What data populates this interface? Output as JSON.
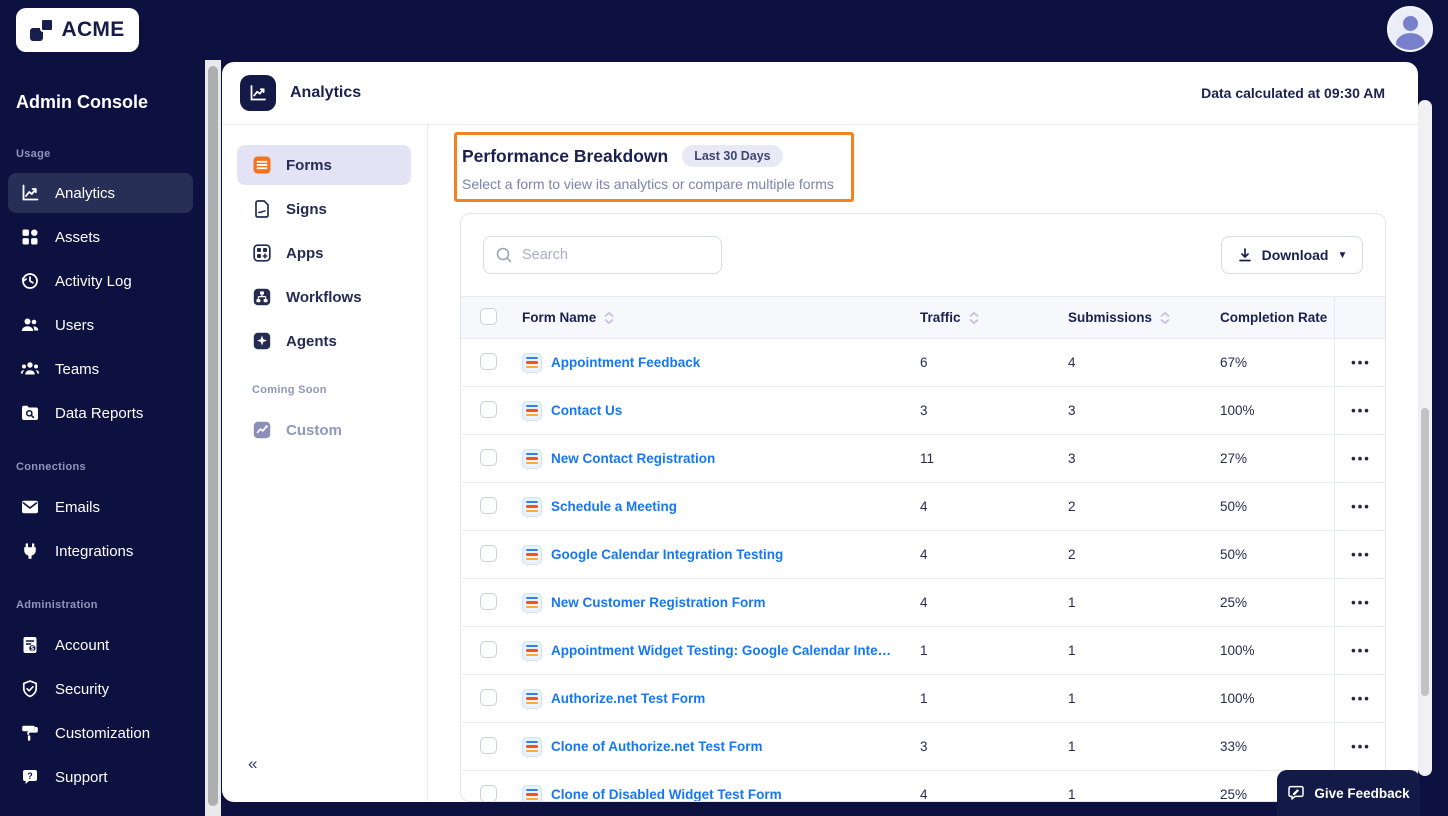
{
  "topbar": {
    "logo_text": "ACME"
  },
  "sidebar": {
    "title": "Admin Console",
    "sections": [
      {
        "label": "Usage",
        "items": [
          {
            "label": "Analytics",
            "active": true
          },
          {
            "label": "Assets"
          },
          {
            "label": "Activity Log"
          },
          {
            "label": "Users"
          },
          {
            "label": "Teams"
          },
          {
            "label": "Data Reports"
          }
        ]
      },
      {
        "label": "Connections",
        "items": [
          {
            "label": "Emails"
          },
          {
            "label": "Integrations"
          }
        ]
      },
      {
        "label": "Administration",
        "items": [
          {
            "label": "Account"
          },
          {
            "label": "Security"
          },
          {
            "label": "Customization"
          },
          {
            "label": "Support"
          }
        ]
      }
    ]
  },
  "header": {
    "title": "Analytics",
    "data_note": "Data calculated at 09:30 AM"
  },
  "subnav": {
    "items": [
      {
        "label": "Forms",
        "active": true
      },
      {
        "label": "Signs"
      },
      {
        "label": "Apps"
      },
      {
        "label": "Workflows"
      },
      {
        "label": "Agents"
      }
    ],
    "coming_soon_label": "Coming Soon",
    "coming_soon_item": "Custom",
    "collapse_glyph": "«"
  },
  "main": {
    "highlight": {
      "title": "Performance Breakdown",
      "badge": "Last 30 Days",
      "subtitle": "Select a form to view its analytics or compare multiple forms",
      "border_color": "#F5821F"
    },
    "toolbar": {
      "search_placeholder": "Search",
      "download_label": "Download",
      "caret_glyph": "▼"
    },
    "table": {
      "columns": [
        "Form Name",
        "Traffic",
        "Submissions",
        "Completion Rate"
      ],
      "rows": [
        {
          "name": "Appointment Feedback",
          "traffic": "6",
          "submissions": "4",
          "completion": "67%"
        },
        {
          "name": "Contact Us",
          "traffic": "3",
          "submissions": "3",
          "completion": "100%"
        },
        {
          "name": "New Contact Registration",
          "traffic": "11",
          "submissions": "3",
          "completion": "27%"
        },
        {
          "name": "Schedule a Meeting",
          "traffic": "4",
          "submissions": "2",
          "completion": "50%"
        },
        {
          "name": "Google Calendar Integration Testing",
          "traffic": "4",
          "submissions": "2",
          "completion": "50%"
        },
        {
          "name": "New Customer Registration Form",
          "traffic": "4",
          "submissions": "1",
          "completion": "25%"
        },
        {
          "name": "Appointment Widget Testing: Google Calendar Inte…",
          "traffic": "1",
          "submissions": "1",
          "completion": "100%"
        },
        {
          "name": "Authorize.net Test Form",
          "traffic": "1",
          "submissions": "1",
          "completion": "100%"
        },
        {
          "name": "Clone of Authorize.net Test Form",
          "traffic": "3",
          "submissions": "1",
          "completion": "33%"
        },
        {
          "name": "Clone of Disabled Widget Test Form",
          "traffic": "4",
          "submissions": "1",
          "completion": "25%"
        }
      ]
    }
  },
  "feedback": {
    "label": "Give Feedback"
  },
  "icons": {
    "ellipsis": "•••"
  },
  "colors": {
    "navy_bg": "#0C1140",
    "accent_orange": "#F5821F",
    "link_blue": "#1777F2",
    "active_sidebar": "#282F56",
    "active_subnav": "#E3E3F5",
    "forms_icon_orange": "#F4731C"
  }
}
